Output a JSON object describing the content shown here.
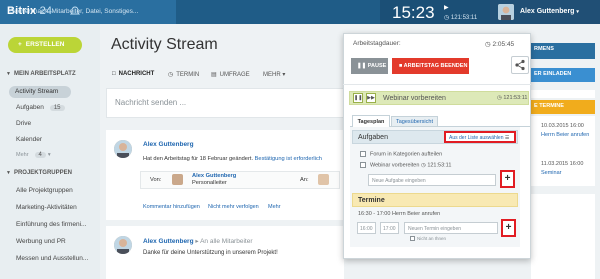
{
  "header": {
    "logo_main": "Bitrix",
    "logo_num": "24",
    "search_placeholder": "Suchen nach: Mitarbeiter, Datei, Sonstiges...",
    "clock": "15:23",
    "clock_sub": "121:53:11",
    "user_name": "Alex Guttenberg"
  },
  "sidebar": {
    "create_label": "ERSTELLEN",
    "section1": "MEIN ARBEITSPLATZ",
    "items1": [
      "Activity Stream",
      "Aufgaben",
      "Drive",
      "Kalender",
      "Mehr"
    ],
    "aufgaben_count": "15",
    "mehr_count": "4",
    "section2": "PROJEKTGRUPPEN",
    "items2": [
      "Alle Projektgruppen",
      "Marketing-Aktivitäten",
      "Einführung des firmeni...",
      "Werbung und PR",
      "Messen und Ausstellun..."
    ]
  },
  "main": {
    "title": "Activity Stream",
    "tabs": [
      "NACHRICHT",
      "TERMIN",
      "UMFRAGE",
      "MEHR"
    ],
    "composer_placeholder": "Nachricht senden ...",
    "post1": {
      "author": "Alex Guttenberg",
      "text": "Hat den Arbeitstag für 18 Februar geändert.",
      "link": "Bestätigung ist erforderlich",
      "von_label": "Von:",
      "von_name": "Alex Guttenberg",
      "von_role": "Personalleiter",
      "an_label": "An:",
      "actions": [
        "Kommentar hinzufügen",
        "Nicht mehr verfolgen",
        "Mehr"
      ]
    },
    "post2": {
      "author": "Alex Guttenberg",
      "arrow": "An alle Mitarbeiter",
      "text": "Danke für deine Unterstützung in unserem Projekt!"
    }
  },
  "popup": {
    "title": "Arbeitstagdauer:",
    "timer_main": "2:05:45",
    "pause_label": "PAUSE",
    "end_label": "ARBEITSTAG BEENDEN",
    "webinar": "Webinar vorbereiten",
    "webinar_time": "121:53:11",
    "tab1": "Tagesplan",
    "tab2": "Tagesübersicht",
    "aufgaben_label": "Aufgaben",
    "from_list": "Aus der Liste auswählen",
    "tasks": [
      "Forum in Kategorien aufteilen",
      "Webinar vorbereiten"
    ],
    "task2_time": "121:53:11",
    "new_task_placeholder": "Neue Aufgabe eingeben",
    "termine_label": "Termine",
    "event_line": "16:30 - 17:00   Herrn Beier anrufen",
    "time_from": "16:00",
    "time_to": "17:00",
    "new_event_placeholder": "Neuen Termin eingeben",
    "busy_label": "Nicht an Ihnen"
  },
  "right": {
    "head1": "RMENS",
    "head2": "ER EINLADEN",
    "head3": "E TERMINE",
    "date1": "10.03.2015 16:00",
    "link1": "Herrn Beier anrufen",
    "date2": "11.03.2015 16:00",
    "link2": "Seminar"
  },
  "colors": {
    "topbar": "#2a6fa0",
    "accent_green": "#bbd537",
    "end_red": "#e33a2b",
    "highlight_red": "#e11c23",
    "link_blue": "#2067b0"
  }
}
